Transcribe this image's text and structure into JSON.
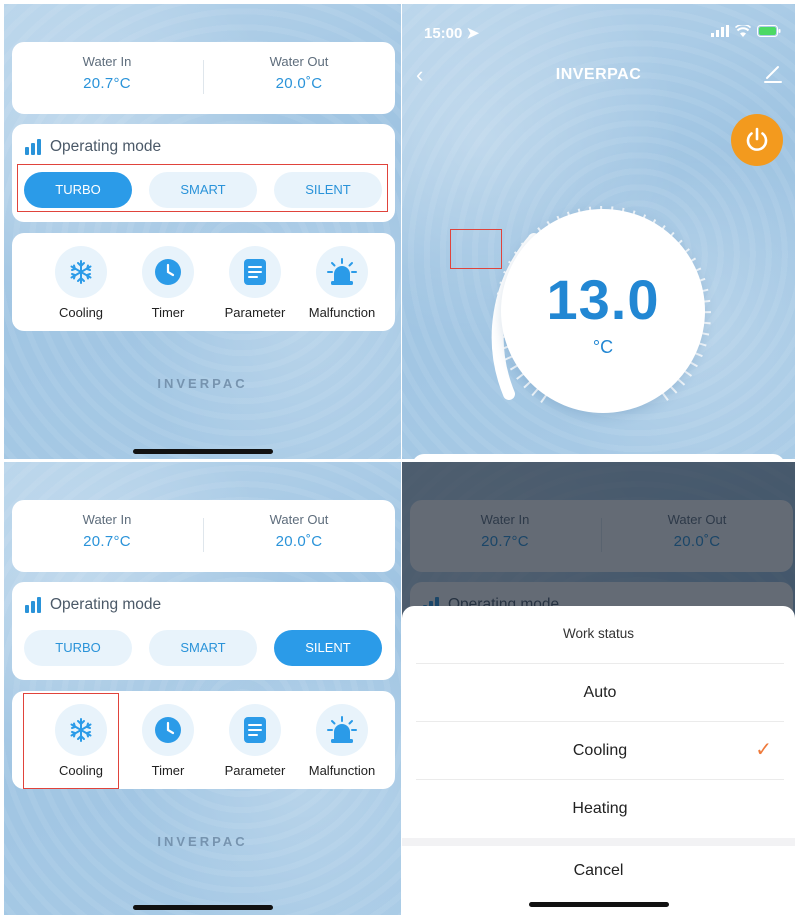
{
  "water": {
    "in_label": "Water In",
    "in_value": "20.7°C",
    "out_label": "Water Out",
    "out_value": "20.0˚C"
  },
  "mode": {
    "title": "Operating mode",
    "buttons": [
      "TURBO",
      "SMART",
      "SILENT"
    ]
  },
  "functions": [
    {
      "label": "Cooling",
      "icon": "snowflake-icon"
    },
    {
      "label": "Timer",
      "icon": "clock-icon"
    },
    {
      "label": "Parameter",
      "icon": "document-icon"
    },
    {
      "label": "Malfunction",
      "icon": "alarm-icon"
    }
  ],
  "brand": "INVERPAC",
  "screens": {
    "top_left": {
      "active_mode": "TURBO"
    },
    "bottom_left": {
      "active_mode": "SILENT"
    }
  },
  "device": {
    "time": "15:00",
    "title": "INVERPAC",
    "temperature": "13.0",
    "unit": "°C"
  },
  "work_status": {
    "title": "Work status",
    "options": [
      "Auto",
      "Cooling",
      "Heating"
    ],
    "selected": "Cooling",
    "check": "✓",
    "cancel": "Cancel"
  },
  "colors": {
    "accent": "#2b9be8",
    "power": "#f39a1e",
    "highlight": "#e0433b",
    "check": "#ef7a3b"
  }
}
